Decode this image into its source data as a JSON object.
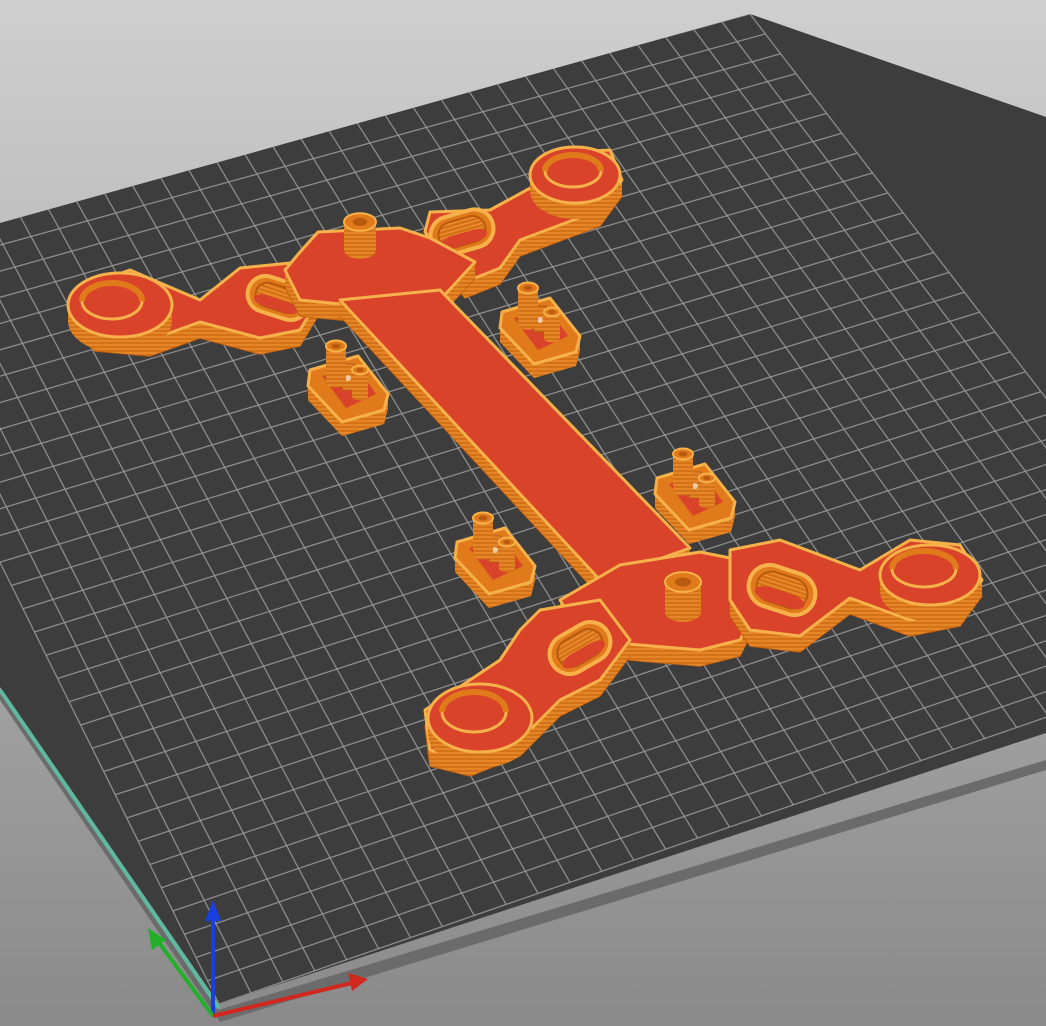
{
  "viewport": {
    "background_top": "#cfcfcf",
    "background_bottom": "#8a8a8a"
  },
  "bed": {
    "surface_color": "#3d3d3d",
    "grid_color": "#9a9a9a",
    "edge_color": "#5fb8a0",
    "side_color": "#6b6b6b"
  },
  "model": {
    "wall_color": "#e07a1a",
    "wall_shadow_color": "#b85a10",
    "top_color": "#d9432a",
    "outline_color": "#f6b14a"
  },
  "axes": {
    "x_color": "#d0281e",
    "y_color": "#22b02a",
    "z_color": "#1a3fe0"
  }
}
